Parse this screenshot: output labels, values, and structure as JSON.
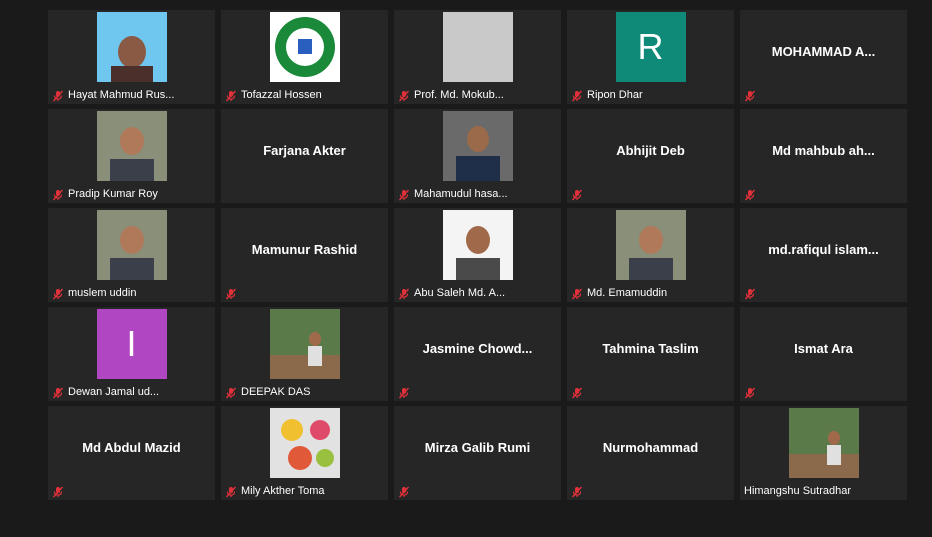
{
  "colors": {
    "background": "#1a1a1a",
    "tile": "#262626",
    "muted_icon": "#e0313a",
    "avatar_r": "#0f8a78",
    "avatar_i": "#b146c2"
  },
  "participants": [
    {
      "name": "Hayat Mahmud Rus...",
      "center": "",
      "avatar": "photo-sky",
      "icon": "muted-mic-icon"
    },
    {
      "name": "Tofazzal Hossen",
      "center": "",
      "avatar": "logo",
      "icon": "muted-mic-icon"
    },
    {
      "name": "Prof. Md. Mokub...",
      "center": "",
      "avatar": "photo-blank",
      "icon": "muted-mic-icon"
    },
    {
      "name": "Ripon Dhar",
      "center": "",
      "avatar": "R",
      "icon": "muted-mic-icon"
    },
    {
      "name": "",
      "center": "MOHAMMAD  A...",
      "avatar": "",
      "icon": "muted-mic-icon"
    },
    {
      "name": "Pradip Kumar Roy",
      "center": "",
      "avatar": "photo-man",
      "icon": "muted-mic-icon"
    },
    {
      "name": "",
      "center": "Farjana Akter",
      "avatar": "",
      "icon": ""
    },
    {
      "name": "Mahamudul hasa...",
      "center": "",
      "avatar": "photo-suit",
      "icon": "muted-mic-icon"
    },
    {
      "name": "",
      "center": "Abhijit Deb",
      "avatar": "",
      "icon": "muted-mic-icon"
    },
    {
      "name": "",
      "center": "Md  mahbub  ah...",
      "avatar": "",
      "icon": "muted-mic-icon"
    },
    {
      "name": "muslem uddin",
      "center": "",
      "avatar": "photo-man",
      "icon": "muted-mic-icon"
    },
    {
      "name": "",
      "center": "Mamunur Rashid",
      "avatar": "",
      "icon": "muted-mic-icon"
    },
    {
      "name": "Abu Saleh Md. A...",
      "center": "",
      "avatar": "photo-white",
      "icon": "muted-mic-icon"
    },
    {
      "name": "Md. Emamuddin",
      "center": "",
      "avatar": "photo-man",
      "icon": "muted-mic-icon"
    },
    {
      "name": "",
      "center": "md.rafiqul  islam...",
      "avatar": "",
      "icon": "muted-mic-icon"
    },
    {
      "name": "Dewan Jamal ud...",
      "center": "",
      "avatar": "I",
      "icon": "muted-mic-icon"
    },
    {
      "name": "DEEPAK DAS",
      "center": "",
      "avatar": "photo-outdoor",
      "icon": "muted-mic-icon"
    },
    {
      "name": "",
      "center": "Jasmine  Chowd...",
      "avatar": "",
      "icon": "muted-mic-icon"
    },
    {
      "name": "",
      "center": "Tahmina Taslim",
      "avatar": "",
      "icon": "muted-mic-icon"
    },
    {
      "name": "",
      "center": "Ismat Ara",
      "avatar": "",
      "icon": "muted-mic-icon"
    },
    {
      "name": "",
      "center": "Md Abdul Mazid",
      "avatar": "",
      "icon": "muted-mic-icon"
    },
    {
      "name": "Mily Akther Toma",
      "center": "",
      "avatar": "photo-flowers",
      "icon": "muted-mic-icon"
    },
    {
      "name": "",
      "center": "Mirza Galib Rumi",
      "avatar": "",
      "icon": "muted-mic-icon"
    },
    {
      "name": "",
      "center": "Nurmohammad",
      "avatar": "",
      "icon": "muted-mic-icon"
    },
    {
      "name": "Himangshu Sutradhar",
      "center": "",
      "avatar": "photo-outdoor",
      "icon": ""
    }
  ]
}
